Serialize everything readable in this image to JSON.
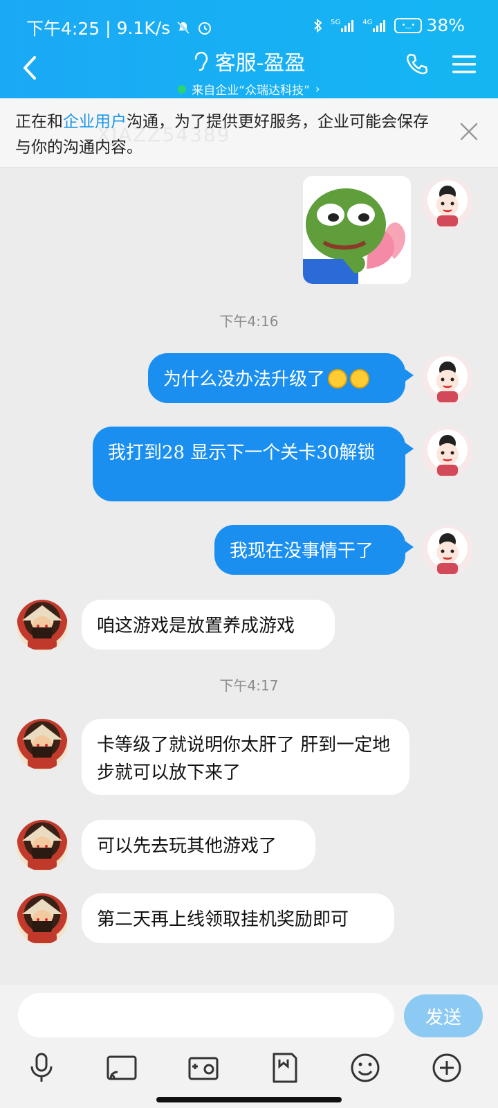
{
  "status_bar": {
    "time": "下午4:25",
    "net_speed": "9.1K/s",
    "signal_1": "5G",
    "signal_2": "4G",
    "battery": "38%"
  },
  "header": {
    "title": "客服-盈盈",
    "subtitle": "来自企业“众瑞达科技”"
  },
  "notice": {
    "text_before": "正在和",
    "highlight": "企业用户",
    "text_after": "沟通，为了提供更好服务，企业可能会保存与你的沟通内容。",
    "watermark": "XJAZZ54389"
  },
  "messages": {
    "ts1": "下午4:16",
    "m1": "为什么没办法升级了",
    "m2": "我打到28  显示下一个关卡30解锁",
    "m3": "我现在没事情干了",
    "m4": "咱这游戏是放置养成游戏",
    "ts2": "下午4:17",
    "m5": "卡等级了就说明你太肝了 肝到一定地步就可以放下来了",
    "m6": "可以先去玩其他游戏了",
    "m7": "第二天再上线领取挂机奖励即可"
  },
  "input": {
    "placeholder": "",
    "send_label": "发送"
  },
  "colors": {
    "header_bg": "#1ba9f5",
    "bubble_me": "#1a8ff0",
    "bubble_other": "#ffffff",
    "send_btn": "#8ccaf3",
    "online": "#2bd66d"
  }
}
